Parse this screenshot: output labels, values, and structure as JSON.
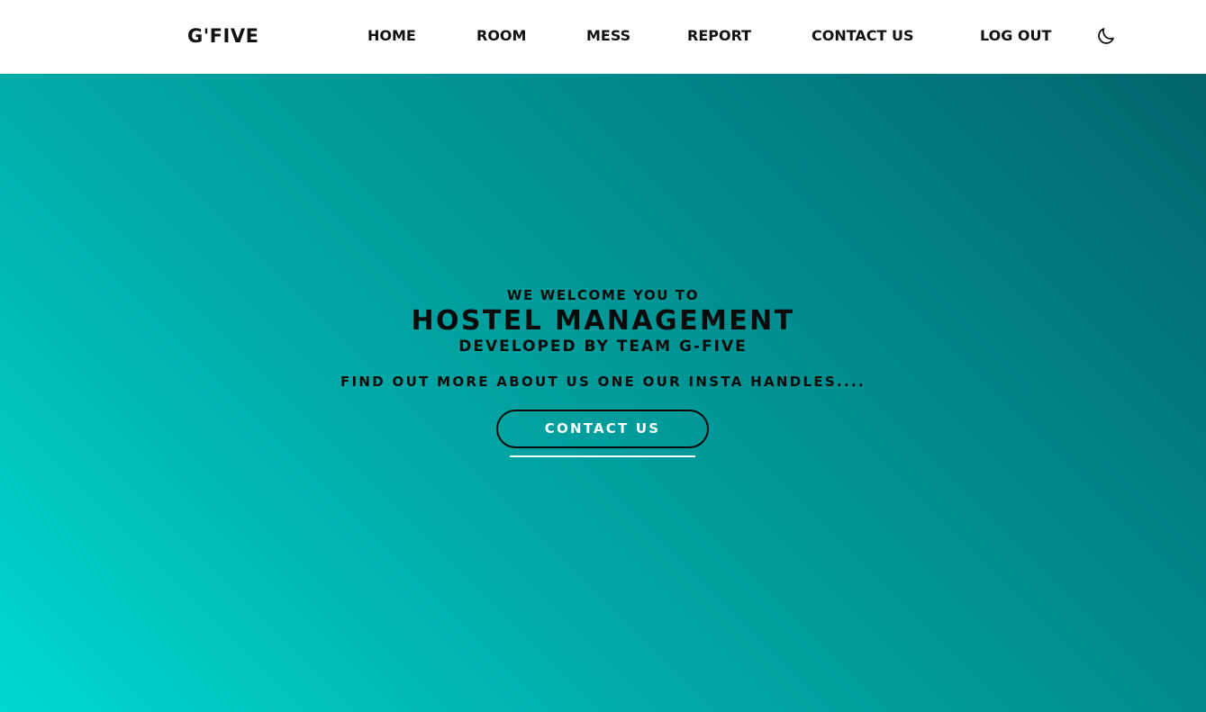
{
  "header": {
    "logo": "G'FIVE",
    "nav": [
      {
        "label": "HOME"
      },
      {
        "label": "ROOM"
      },
      {
        "label": "MESS"
      },
      {
        "label": "REPORT"
      },
      {
        "label": "CONTACT US"
      },
      {
        "label": "LOG OUT"
      }
    ],
    "theme_toggle_icon": "moon-icon"
  },
  "hero": {
    "welcome": "WE WELCOME YOU TO",
    "title": "HOSTEL MANAGEMENT",
    "developed_by": "DEVELOPED BY TEAM G-FIVE",
    "find_out": "FIND OUT MORE ABOUT US ONE OUR INSTA HANDLES....",
    "contact_button": "CONTACT US"
  },
  "colors": {
    "gradient_start": "#00d8d2",
    "gradient_end": "#02656d",
    "navbar_bg": "#ffffff",
    "text": "#0b0b0b"
  }
}
